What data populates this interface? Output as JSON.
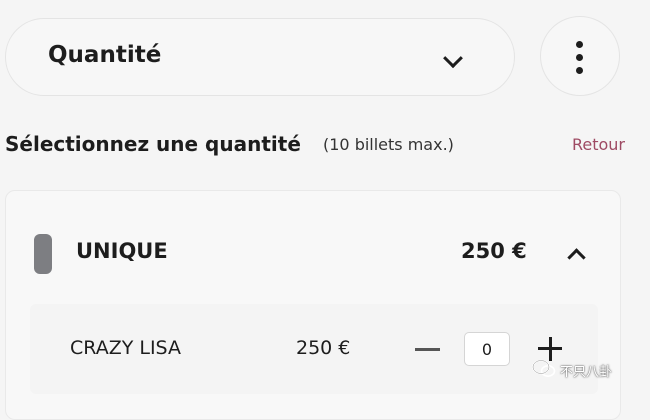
{
  "quantity_select": {
    "label": "Quantité",
    "icon": "chevron-down-icon"
  },
  "more_menu": {
    "icon": "more-vertical-icon"
  },
  "section": {
    "title": "Sélectionnez une quantité",
    "subtitle": "(10 billets max.)",
    "back_label": "Retour"
  },
  "category": {
    "name": "UNIQUE",
    "price": "250 €",
    "icon": "chevron-up-icon",
    "indicator_color": "#7d7e82",
    "tickets": [
      {
        "name": "CRAZY LISA",
        "price": "250 €",
        "quantity": "0"
      }
    ]
  },
  "watermark": {
    "text": "不只八卦",
    "icon": "wechat-icon"
  },
  "colors": {
    "background": "#f5f5f5",
    "accent_link": "#9e4a63",
    "text": "#1d1d1d"
  }
}
